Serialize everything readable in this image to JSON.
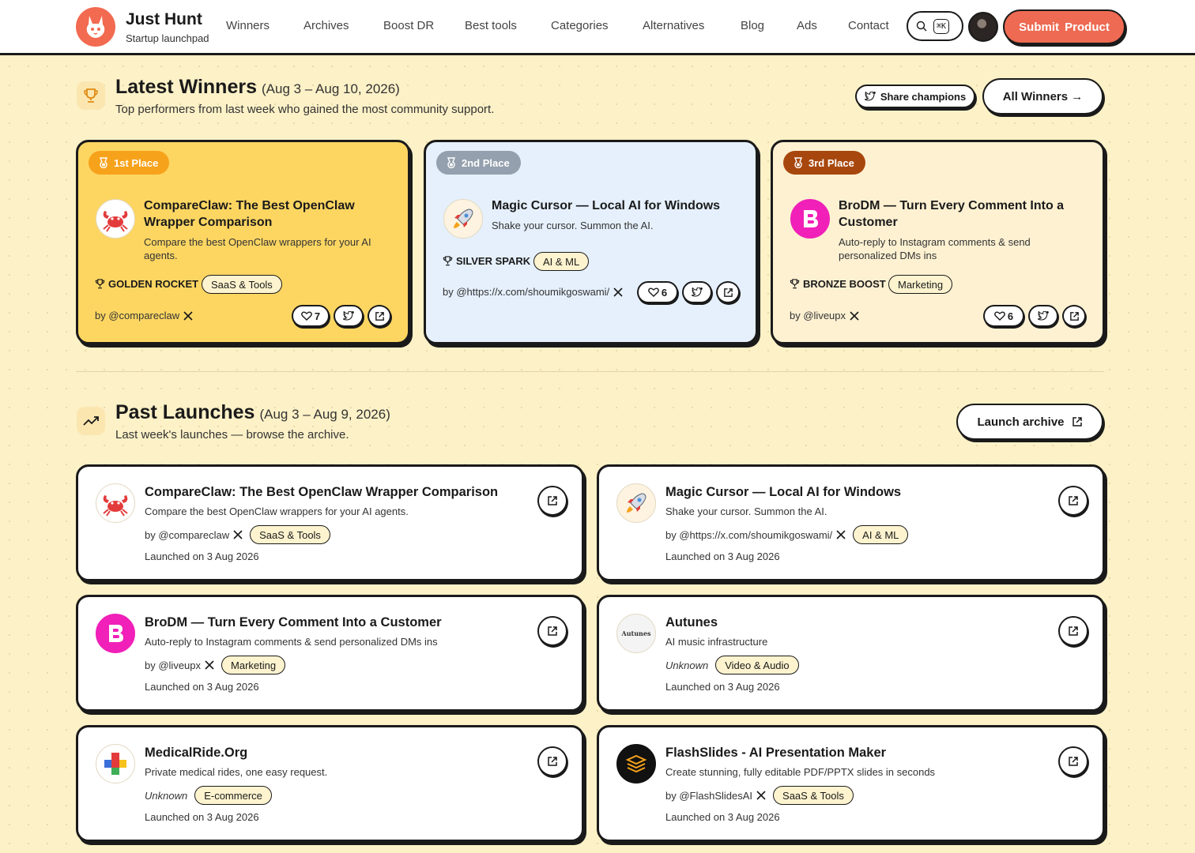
{
  "header": {
    "brand": "Just Hunt",
    "tagline": "Startup launchpad",
    "nav": [
      "Winners",
      "Archives",
      "Boost DR",
      "Best tools",
      "Categories",
      "Alternatives",
      "Blog",
      "Ads",
      "Contact"
    ],
    "search_shortcut": "⌘K",
    "submit_label": "Submit Product"
  },
  "winners": {
    "title": "Latest Winners",
    "range": "(Aug 3 – Aug 10, 2026)",
    "subtitle": "Top performers from last week who gained the most community support.",
    "share_label": "Share champions",
    "all_label": "All Winners →",
    "cards": [
      {
        "place": "1st Place",
        "title": "CompareClaw: The Best OpenClaw Wrapper Comparison",
        "desc": "Compare the best OpenClaw wrappers for your AI agents.",
        "award": "GOLDEN ROCKET",
        "tag": "SaaS & Tools",
        "by": "by @compareclaw",
        "votes": "7"
      },
      {
        "place": "2nd Place",
        "title": "Magic Cursor — Local AI for Windows",
        "desc": "Shake your cursor. Summon the AI.",
        "award": "SILVER SPARK",
        "tag": "AI & ML",
        "by": "by @https://x.com/shoumikgoswami/",
        "votes": "6"
      },
      {
        "place": "3rd Place",
        "title": "BroDM — Turn Every Comment Into a Customer",
        "desc": "Auto-reply to Instagram comments & send personalized DMs ins",
        "award": "BRONZE BOOST",
        "tag": "Marketing",
        "by": "by @liveupx",
        "votes": "6"
      }
    ]
  },
  "past": {
    "title": "Past Launches",
    "range": "(Aug 3 – Aug 9, 2026)",
    "subtitle": "Last week's launches — browse the archive.",
    "archive_label": "Launch archive",
    "items": [
      {
        "title": "CompareClaw: The Best OpenClaw Wrapper Comparison",
        "desc": "Compare the best OpenClaw wrappers for your AI agents.",
        "by": "by @compareclaw",
        "tag": "SaaS & Tools",
        "launched": "Launched on 3 Aug 2026"
      },
      {
        "title": "Magic Cursor — Local AI for Windows",
        "desc": "Shake your cursor. Summon the AI.",
        "by": "by @https://x.com/shoumikgoswami/",
        "tag": "AI & ML",
        "launched": "Launched on 3 Aug 2026"
      },
      {
        "title": "BroDM — Turn Every Comment Into a Customer",
        "desc": "Auto-reply to Instagram comments & send personalized DMs ins",
        "by": "by @liveupx",
        "tag": "Marketing",
        "launched": "Launched on 3 Aug 2026"
      },
      {
        "title": "Autunes",
        "desc": "AI music infrastructure",
        "by": "Unknown",
        "tag": "Video & Audio",
        "launched": "Launched on 3 Aug 2026",
        "logo_text": "Autunes"
      },
      {
        "title": "MedicalRide.Org",
        "desc": "Private medical rides, one easy request.",
        "by": "Unknown",
        "tag": "E-commerce",
        "launched": "Launched on 3 Aug 2026"
      },
      {
        "title": "FlashSlides - AI Presentation Maker",
        "desc": "Create stunning, fully editable PDF/PPTX slides in seconds",
        "by": "by @FlashSlidesAI",
        "tag": "SaaS & Tools",
        "launched": "Launched on 3 Aug 2026"
      }
    ]
  },
  "colors": {
    "background": "#fdf1c7",
    "accent": "#ee6a52",
    "gold": "#fdd662",
    "silver_card": "#e5f0fc",
    "bronze_card": "#fdf1d2",
    "gold_badge": "#f7a21b",
    "silver_badge": "#94a0ad",
    "bronze_badge": "#a8470d"
  },
  "icons": [
    "rabbit-logo-icon",
    "search-icon",
    "trophy-icon",
    "trending-up-icon",
    "award-icon",
    "medal-icon",
    "heart-icon",
    "twitter-bird-icon",
    "external-link-icon",
    "x-logo-icon",
    "crab-icon",
    "rocket-icon",
    "brodm-logo-icon",
    "medical-cross-icon",
    "stack-icon"
  ]
}
